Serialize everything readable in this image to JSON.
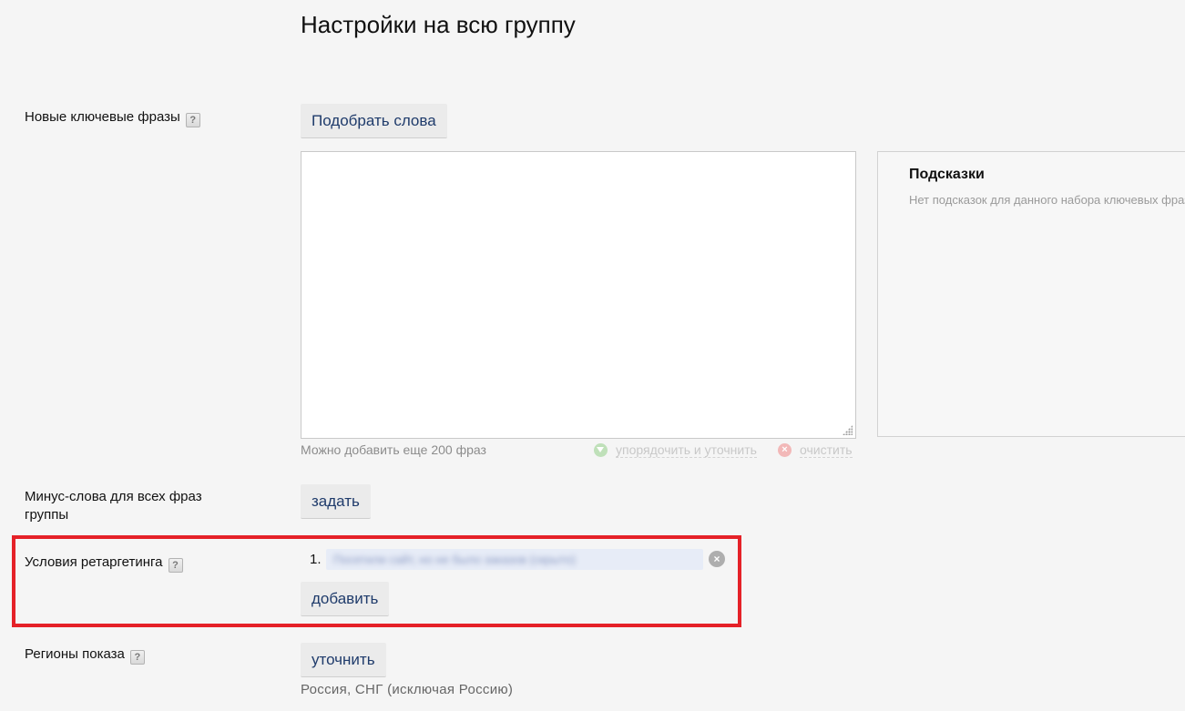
{
  "page": {
    "title": "Настройки на всю группу"
  },
  "keywords": {
    "label": "Новые ключевые фразы",
    "help": "?",
    "pick_button": "Подобрать слова",
    "textarea_value": "",
    "remaining": "Можно добавить еще 200 фраз",
    "sort_link": "упорядочить и уточнить",
    "clear_link": "очистить",
    "clear_icon": "×"
  },
  "hints": {
    "title": "Подсказки",
    "text": "Нет подсказок для данного набора ключевых фраз"
  },
  "minus_words": {
    "label": "Минус-слова для всех фраз группы",
    "set_button": "задать"
  },
  "retargeting": {
    "label": "Условия ретаргетинга",
    "help": "?",
    "items": [
      {
        "num": "1.",
        "text": "Посетили сайт, но не было заказов (скрыто)",
        "remove": "×"
      }
    ],
    "add_button": "добавить"
  },
  "regions": {
    "label": "Регионы показа",
    "help": "?",
    "refine_button": "уточнить",
    "value": "Россия, СНГ (исключая Россию)"
  },
  "colors": {
    "highlight": "#e52128",
    "button_text": "#1f3b6b",
    "background": "#f5f5f5"
  }
}
